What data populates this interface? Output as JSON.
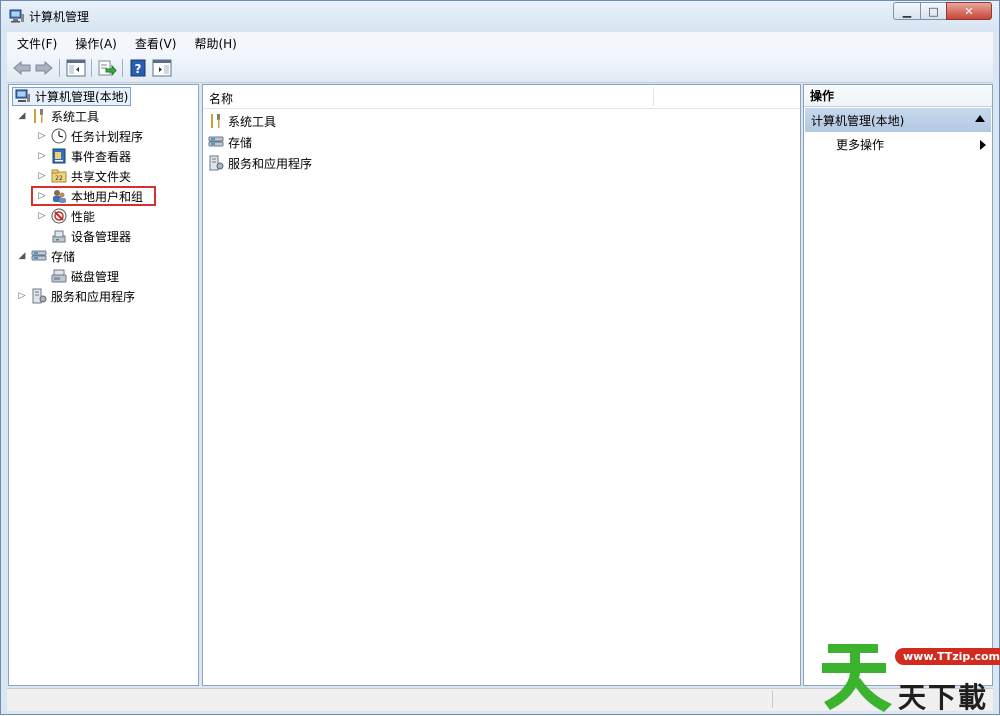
{
  "window": {
    "title": "计算机管理"
  },
  "menu": [
    {
      "label": "文件(F)"
    },
    {
      "label": "操作(A)"
    },
    {
      "label": "查看(V)"
    },
    {
      "label": "帮助(H)"
    }
  ],
  "toolbar": {
    "buttons": [
      "back-arrow-icon",
      "forward-arrow-icon",
      "show-hide-tree-icon",
      "export-list-icon",
      "help-icon",
      "show-hide-action-pane-icon"
    ]
  },
  "tree": {
    "root": "计算机管理(本地)",
    "system_tools": "系统工具",
    "task_scheduler": "任务计划程序",
    "event_viewer": "事件查看器",
    "shared_folders": "共享文件夹",
    "local_users": "本地用户和组",
    "performance": "性能",
    "device_manager": "设备管理器",
    "storage": "存储",
    "disk_management": "磁盘管理",
    "services_apps": "服务和应用程序"
  },
  "center": {
    "column_name": "名称",
    "items": [
      "系统工具",
      "存储",
      "服务和应用程序"
    ]
  },
  "actions": {
    "header": "操作",
    "section": "计算机管理(本地)",
    "more": "更多操作"
  },
  "watermark": {
    "url": "www.TTzip.com",
    "text": "天下載"
  },
  "colors": {
    "highlight": "#d6302a",
    "selection_bg": "#e7f0fb",
    "section_bg": "#b3c9e3"
  }
}
